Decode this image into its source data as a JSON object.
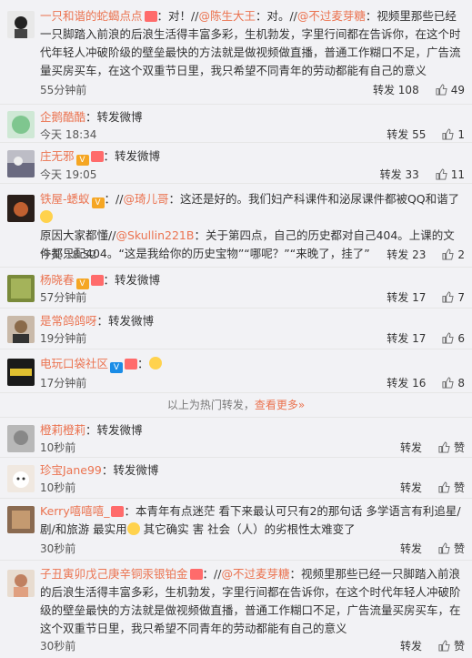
{
  "comments": [
    {
      "name": "一只和谐的蛇蝎点点",
      "colon": "：对！//",
      "mention1": "@陈生大王",
      "mid": "：对。//",
      "mention2": "@不过麦芽糖",
      "text": "：视频里那些已经一只脚踏入前浪的后浪生活得丰富多彩，生机勃发，字里行间都在告诉你，在这个时代年轻人冲破阶级的壁垒最快的方法就是做视频做直播，普通工作糊口不足，广告流量买房买车，在这个双重节日里，我只希望不同青年的劳动都能有自己的意义",
      "time": "55分钟前",
      "repost": "转发 108",
      "likes": "49"
    },
    {
      "name": "企鹅酷酷",
      "text": "：转发微博",
      "time": "今天 18:34",
      "repost": "转发 55",
      "likes": "1"
    },
    {
      "name": "庄无邪",
      "text": "：转发微博",
      "time": "今天 19:05",
      "repost": "转发 33",
      "likes": "11"
    },
    {
      "name": "铁屋-蟋蚁",
      "colon": "：//",
      "mention1": "@琦儿哥",
      "text1": "：这还是好的。我们妇产科课件和泌尿课件都被QQ和谐了",
      "line2a": "原因大家都懂//",
      "mention2": "@Skullin221B",
      "text2": "：关于第四点，自己的历史都对自己404。上课的文件都只配404。“这是我给你的历史宝物”“哪呢？”“来晚了，挂了”",
      "time": "今天 18:52",
      "repost": "转发 23",
      "likes": "2"
    },
    {
      "name": "杨晓春",
      "text": "：转发微博",
      "time": "57分钟前",
      "repost": "转发 17",
      "likes": "7"
    },
    {
      "name": "是常鸽鸽呀",
      "text": "：转发微博",
      "time": "19分钟前",
      "repost": "转发 17",
      "likes": "6"
    },
    {
      "name": "电玩口袋社区",
      "text": "：",
      "time": "17分钟前",
      "repost": "转发 16",
      "likes": "8"
    },
    {
      "name": "橙莉橙莉",
      "text": "：转发微博",
      "time": "10秒前",
      "repost": "转发",
      "likes": "赞"
    },
    {
      "name": "珍宝Jane99",
      "text": "：转发微博",
      "time": "10秒前",
      "repost": "转发",
      "likes": "赞"
    },
    {
      "name": "Kerry嘻嘻嘻_",
      "text": "：本青年有点迷茫 看下来最认可只有2的那句话 多学语言有利追星/剧/和旅游 最实用",
      "text2": "其它确实 害 社会（人）的劣根性太难变了",
      "time": "30秒前",
      "repost": "转发",
      "likes": "赞"
    },
    {
      "name": "子丑寅卯戊己庚辛铜汞银铂金",
      "colon": "：//",
      "mention": "@不过麦芽糖",
      "text": "：视频里那些已经一只脚踏入前浪的后浪生活得丰富多彩，生机勃发，字里行间都在告诉你，在这个时代年轻人冲破阶级的壁垒最快的方法就是做视频做直播，普通工作糊口不足，广告流量买房买车，在这个双重节日里，我只希望不同青年的劳动都能有自己的意义",
      "time": "30秒前",
      "repost": "转发",
      "likes": "赞"
    }
  ],
  "divider": {
    "text": "以上为热门转发，",
    "link": "查看更多»"
  },
  "colors": {
    "accent": "#eb7350",
    "background": "#f2f2f5"
  }
}
